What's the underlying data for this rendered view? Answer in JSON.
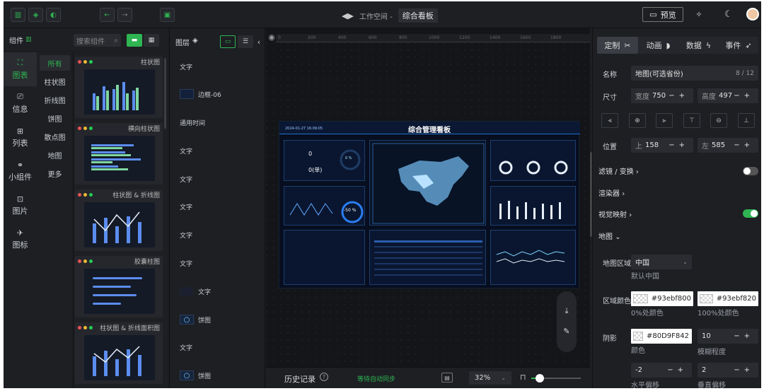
{
  "toolbar": {
    "breadcrumb": "工作空间 -",
    "project": "综合看板",
    "preview": "预览",
    "brand": "#2fb552"
  },
  "rail": [
    {
      "icon": "chart-icon",
      "label": "图表"
    },
    {
      "icon": "info-icon",
      "label": "信息"
    },
    {
      "icon": "list-icon",
      "label": "列表"
    },
    {
      "icon": "widget-icon",
      "label": "小组件"
    },
    {
      "icon": "image-icon",
      "label": "图片"
    },
    {
      "icon": "icons-icon",
      "label": "图标"
    }
  ],
  "left_header": {
    "title": "组件",
    "search_placeholder": "搜索组件"
  },
  "subcats": [
    "所有",
    "柱状图",
    "折线图",
    "饼图",
    "散点图",
    "地图",
    "更多"
  ],
  "components": [
    "柱状图",
    "横向柱状图",
    "柱状图 & 折线图",
    "胶囊柱图",
    "柱状图 & 折线面积图"
  ],
  "layers_title": "图层",
  "layers": [
    "文字",
    "边框-06",
    "通用时间",
    "文字",
    "文字",
    "文字",
    "文字",
    "文字",
    "文字",
    "饼图",
    "文字",
    "饼图"
  ],
  "dashboard": {
    "title": "综合管理看板",
    "date": "2024-01-27 16:09:05",
    "ratio": "-50 %",
    "pct": "0 %",
    "val1": "0",
    "val2": "0(单)"
  },
  "bottombar": {
    "history": "历史记录",
    "sync": "等待自动同步",
    "zoom": "32%"
  },
  "props": {
    "tabs": [
      "定制",
      "动画",
      "数据",
      "事件"
    ],
    "name_label": "名称",
    "name_value": "地图(可选省份)",
    "name_count": "8 / 12",
    "size_label": "尺寸",
    "width_label": "宽度",
    "width": "750",
    "height_label": "高度",
    "height": "497",
    "pos_label": "位置",
    "top_label": "上",
    "top": "158",
    "left_label": "左",
    "left": "585",
    "filter": "滤镜 / 变换",
    "renderer": "渲染器",
    "visual_map": "视觉映射",
    "map": "地图",
    "area_label": "地图区域",
    "area_value": "中国",
    "area_default": "默认中国",
    "color_label": "区域颜色",
    "color0": "#93ebf800",
    "color0_sub": "0%处颜色",
    "color1": "#93ebf820",
    "color1_sub": "100%处颜色",
    "shadow_label": "阴影",
    "shadow_color": "#80D9F842",
    "shadow_color_sub": "颜色",
    "blur": "10",
    "blur_sub": "模糊程度",
    "offset_x": "-2",
    "offset_x_sub": "水平偏移",
    "offset_y": "2",
    "offset_y_sub": "垂直偏移"
  }
}
